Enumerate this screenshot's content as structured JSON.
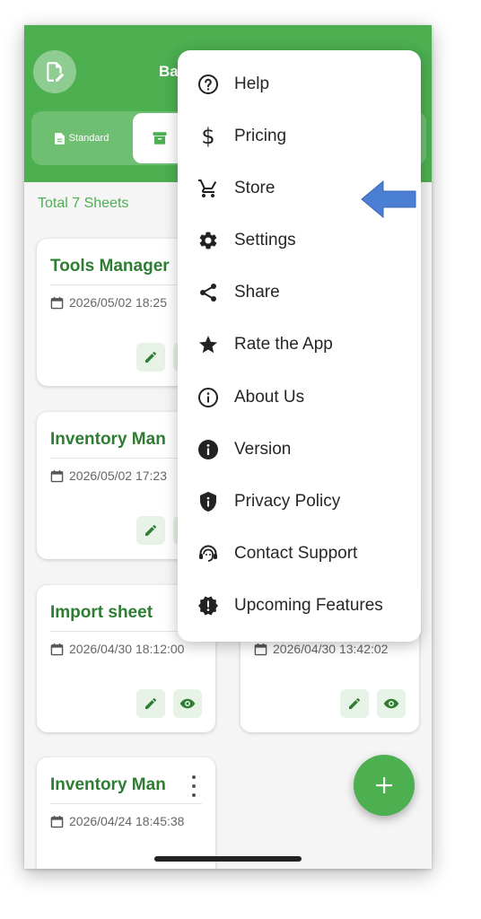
{
  "app": {
    "title": "Ba"
  },
  "tabs": {
    "standard_label": "Standard"
  },
  "summary": {
    "total": "Total 7 Sheets"
  },
  "cards": [
    {
      "title": "Tools Manager",
      "date": "2026/05/02 18:25"
    },
    {
      "title": "Inventory Man",
      "date": "2026/05/02 17:23"
    },
    {
      "title": "Import sheet",
      "date": "2026/04/30 18:12:00"
    },
    {
      "title": "",
      "date": "2026/04/30 13:42:02"
    },
    {
      "title": "Inventory Man",
      "date": "2026/04/24 18:45:38"
    }
  ],
  "menu": {
    "items": [
      {
        "label": "Help",
        "icon": "help-circle-icon"
      },
      {
        "label": "Pricing",
        "icon": "dollar-icon"
      },
      {
        "label": "Store",
        "icon": "cart-icon"
      },
      {
        "label": "Settings",
        "icon": "gear-icon"
      },
      {
        "label": "Share",
        "icon": "share-icon"
      },
      {
        "label": "Rate the App",
        "icon": "star-icon"
      },
      {
        "label": "About Us",
        "icon": "info-outline-icon"
      },
      {
        "label": "Version",
        "icon": "info-filled-icon"
      },
      {
        "label": "Privacy Policy",
        "icon": "shield-icon"
      },
      {
        "label": "Contact Support",
        "icon": "support-agent-icon"
      },
      {
        "label": "Upcoming Features",
        "icon": "new-releases-icon"
      }
    ]
  },
  "colors": {
    "primary": "#4caf50",
    "title_green": "#2e7d32",
    "annotation_arrow": "#4a7fd4"
  }
}
